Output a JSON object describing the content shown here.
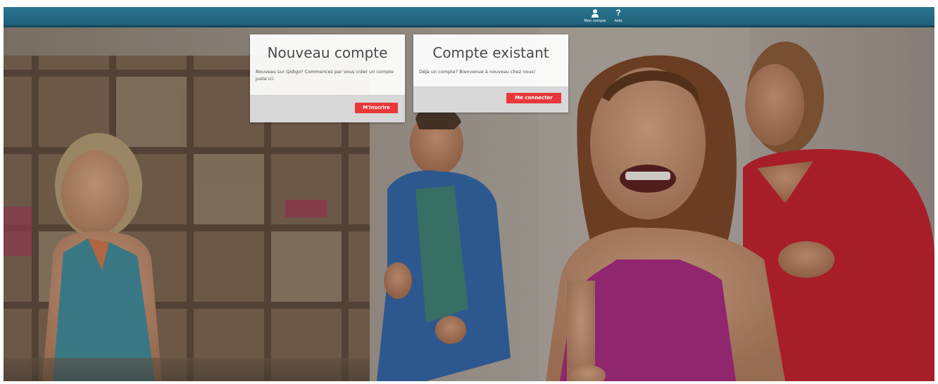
{
  "topbar": {
    "account_label": "Mon compte",
    "help_label": "Aide",
    "account_icon": "user-icon",
    "help_icon": "question-mark-icon",
    "help_glyph": "?",
    "bar_color": "#236a84"
  },
  "cards": {
    "new_account": {
      "title": "Nouveau compte",
      "text": "Nouveau sur Qidigo? Commencez par vous créer un compte juste ici.",
      "button_label": "M'inscrire"
    },
    "existing_account": {
      "title": "Compte existant",
      "text": "Déjà un compte? Bienvenue à nouveau chez nous!",
      "button_label": "Me connecter"
    }
  },
  "colors": {
    "button_red": "#e8383a",
    "card_footer": "#d8d8d8"
  }
}
